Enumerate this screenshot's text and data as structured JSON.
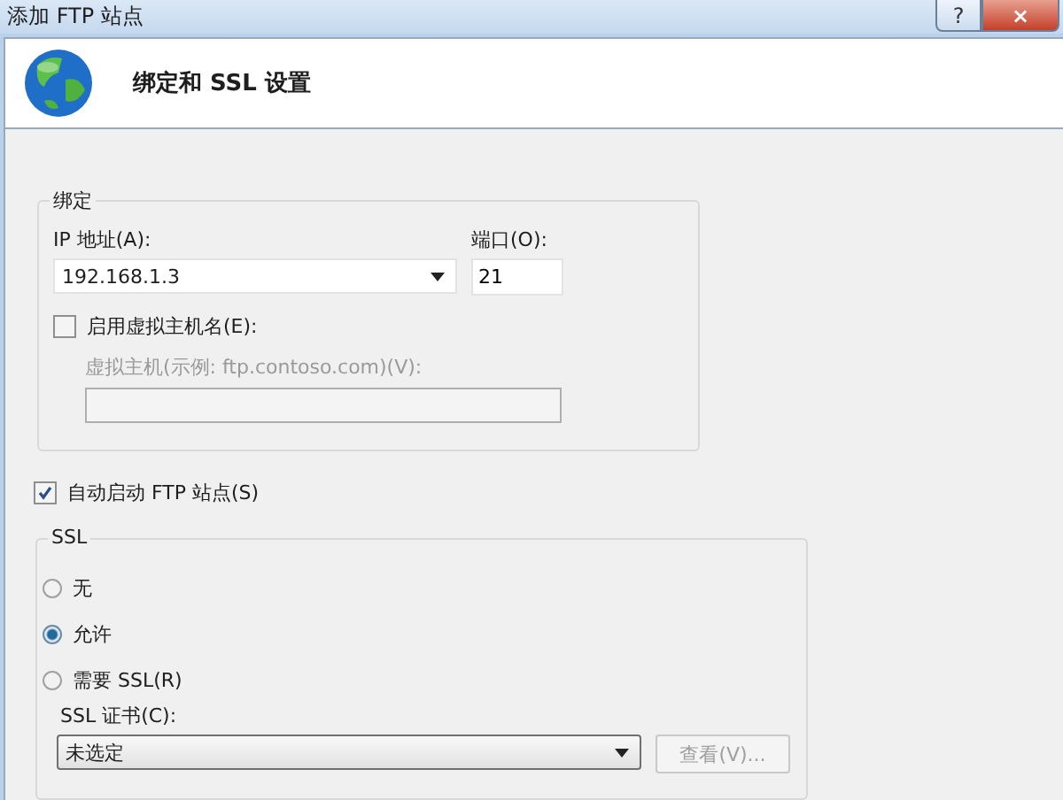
{
  "window": {
    "title": "添加 FTP 站点",
    "help": "?",
    "close": "×"
  },
  "header": {
    "title": "绑定和 SSL 设置"
  },
  "binding": {
    "legend": "绑定",
    "ip_label": "IP 地址(A):",
    "ip_value": "192.168.1.3",
    "port_label": "端口(O):",
    "port_value": "21",
    "virtual_host": {
      "label": "启用虚拟主机名(E):",
      "checked": false
    },
    "host_label": "虚拟主机(示例: ftp.contoso.com)(V):",
    "host_disabled": true
  },
  "auto_start": {
    "label": "自动启动 FTP 站点(S)",
    "checked": true
  },
  "ssl": {
    "legend": "SSL",
    "options": [
      {
        "label": "无",
        "selected": false
      },
      {
        "label": "允许",
        "selected": true
      },
      {
        "label": "需要 SSL(R)",
        "selected": false
      }
    ],
    "cert_label": "SSL 证书(C):",
    "cert_value": "未选定",
    "view_button": {
      "label": "查看(V)...",
      "disabled": true
    }
  }
}
